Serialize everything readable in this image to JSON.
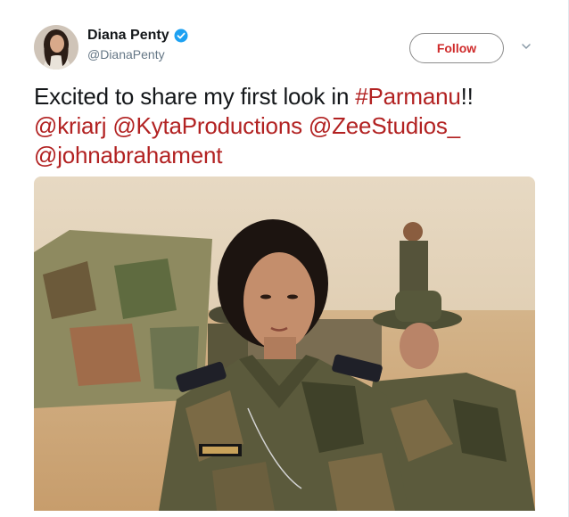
{
  "user": {
    "display_name": "Diana Penty",
    "handle": "@DianaPenty",
    "verified": true,
    "avatar_icon": "profile-photo"
  },
  "actions": {
    "follow_label": "Follow",
    "menu_icon": "chevron-down-icon"
  },
  "tweet": {
    "text_prefix": "Excited to share my first look in ",
    "hashtag": "#Parmanu",
    "text_suffix": "!! ",
    "mentions": [
      "@kriarj",
      "@KytaProductions",
      "@ZeeStudios_",
      "@johnabrahament"
    ]
  },
  "media": {
    "description_icon": "photo-soldier-in-camouflage"
  },
  "colors": {
    "link": "#b22222",
    "follow_text": "#cf2b2b",
    "verified": "#1da1f2"
  }
}
